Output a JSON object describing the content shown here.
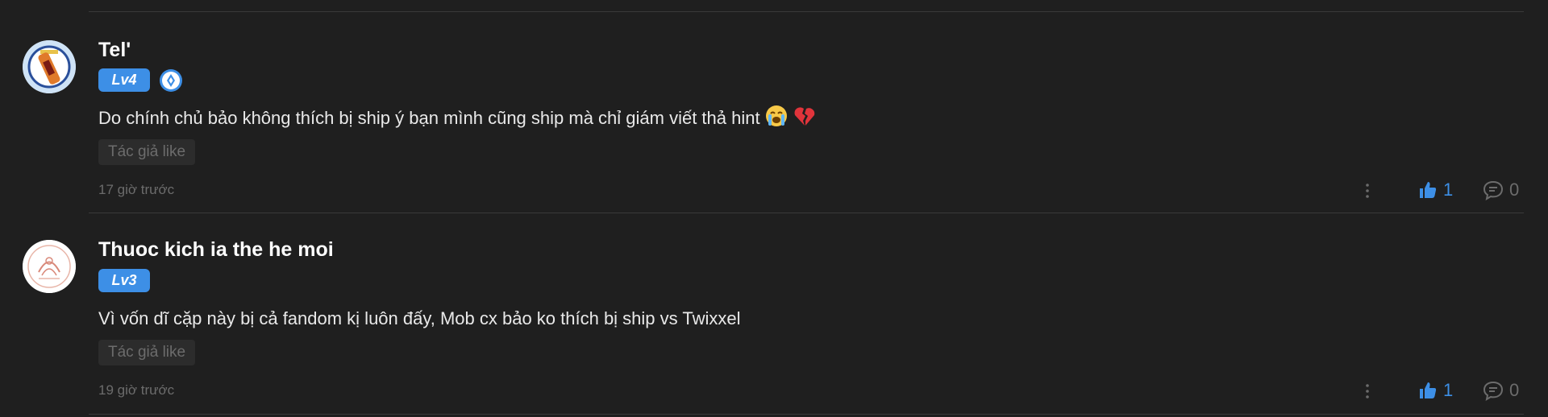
{
  "comments": [
    {
      "username": "Tel'",
      "level": "Lv4",
      "has_medal": true,
      "text": "Do chính chủ bảo không thích bị ship ý bạn mình cũng ship mà chỉ giám viết thả hint",
      "emojis": [
        "loudly-crying-face",
        "broken-heart"
      ],
      "author_like_label": "Tác giả like",
      "timestamp": "17 giờ trước",
      "likes": "1",
      "replies": "0"
    },
    {
      "username": "Thuoc kich ia the he moi",
      "level": "Lv3",
      "has_medal": false,
      "text": "Vì vốn dĩ cặp này bị cả fandom kị luôn đấy, Mob cx bảo ko thích bị ship vs Twixxel",
      "author_like_label": "Tác giả like",
      "timestamp": "19 giờ trước",
      "likes": "1",
      "replies": "0"
    }
  ],
  "colors": {
    "background": "#1f1f1f",
    "accent": "#3d8fe6",
    "muted": "#6c6c6c",
    "divider": "#3a3a3a"
  }
}
